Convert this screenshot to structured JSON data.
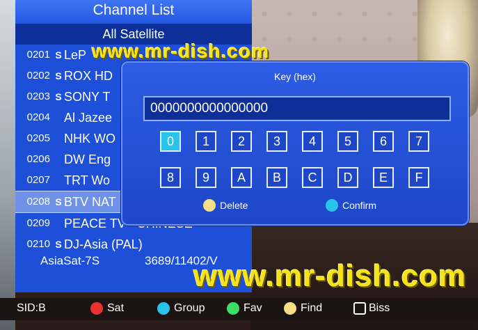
{
  "panel": {
    "title": "Channel List",
    "subtitle": "All Satellite",
    "channels": [
      {
        "num": "0201",
        "scrambled": true,
        "name": "LeP",
        "selected": false
      },
      {
        "num": "0202",
        "scrambled": true,
        "name": "ROX HD",
        "selected": false
      },
      {
        "num": "0203",
        "scrambled": true,
        "name": "SONY T",
        "selected": false
      },
      {
        "num": "0204",
        "scrambled": false,
        "name": "Al Jazee",
        "selected": false
      },
      {
        "num": "0205",
        "scrambled": false,
        "name": "NHK WO",
        "selected": false
      },
      {
        "num": "0206",
        "scrambled": false,
        "name": "DW Eng",
        "selected": false
      },
      {
        "num": "0207",
        "scrambled": false,
        "name": "TRT Wo",
        "selected": false
      },
      {
        "num": "0208",
        "scrambled": true,
        "name": "BTV NAT",
        "selected": true
      },
      {
        "num": "0209",
        "scrambled": false,
        "name": "PEACE TV - CHINESE",
        "selected": false
      },
      {
        "num": "0210",
        "scrambled": true,
        "name": "DJ-Asia (PAL)",
        "selected": false
      }
    ],
    "scrambled_glyph": "S",
    "satellite": "AsiaSat-7S",
    "frequency": "3689/11402/V"
  },
  "dialog": {
    "title": "Key (hex)",
    "value": "0000000000000000",
    "keys_row1": [
      "0",
      "1",
      "2",
      "3",
      "4",
      "5",
      "6",
      "7"
    ],
    "keys_row2": [
      "8",
      "9",
      "A",
      "B",
      "C",
      "D",
      "E",
      "F"
    ],
    "focused_key": "0",
    "delete_label": "Delete",
    "confirm_label": "Confirm",
    "delete_color": "#f4df86",
    "confirm_color": "#27c3ea"
  },
  "bottombar": {
    "sid": "SID:B",
    "sat": {
      "label": "Sat",
      "color": "#e83232"
    },
    "group": {
      "label": "Group",
      "color": "#27c3ea"
    },
    "fav": {
      "label": "Fav",
      "color": "#3ddc63"
    },
    "find": {
      "label": "Find",
      "color": "#f4df86"
    },
    "biss": {
      "label": "Biss"
    }
  },
  "watermark": {
    "text1": "www.mr-dish.com",
    "text2": "www.mr-dish.com"
  }
}
